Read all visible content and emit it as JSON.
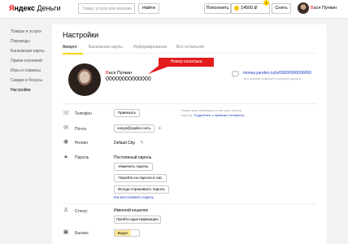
{
  "header": {
    "logo_part1": "Я",
    "logo_part2": "ндекс",
    "logo_part3": "Деньги",
    "search_placeholder": "Товар, услуги или магазин",
    "search_button": "Найти",
    "topup_button": "Пополнить",
    "balance": "14500 ₽",
    "notification_count": "1",
    "withdraw_button": "Снять",
    "user_first_letter": "В",
    "user_rest": "ася Пупкин"
  },
  "sidebar": {
    "items": [
      {
        "label": "Товары и услуги"
      },
      {
        "label": "Переводы"
      },
      {
        "label": "Банковские карты"
      },
      {
        "label": "Прием платежей"
      },
      {
        "label": "Игры и сервисы"
      },
      {
        "label": "Скидки и бонусы"
      },
      {
        "label": "Настройки"
      }
    ]
  },
  "main": {
    "title": "Настройки",
    "tabs": [
      {
        "label": "Аккаунт"
      },
      {
        "label": "Банковские карты"
      },
      {
        "label": "Информирование"
      },
      {
        "label": "Все остальное"
      }
    ],
    "profile": {
      "name_first_letter": "В",
      "name_rest": "ася Пупкин",
      "wallet_number": "00000000000000",
      "callout": "Номер кошелька",
      "public_link": "money.yandex.ru/to/00000000000000",
      "public_link_note": "Эта ссылка помогает получать деньги"
    },
    "phone": {
      "label": "Телефон",
      "button": "Привязать",
      "note_line1": "Нужен для переводов и смс для сброса",
      "note_line2_text": "пароля.",
      "note_line2_link": "Подробнее о привязке телефона"
    },
    "email": {
      "label": "Почта",
      "value": "vasya@yapkin.com"
    },
    "region": {
      "label": "Регион",
      "value": "Default City"
    },
    "password": {
      "label": "Пароль",
      "value": "Постоянный пароль",
      "change_button": "Изменить пароль",
      "one_time_button": "Перейти на пароли в смс",
      "always_ask_button": "Всегда спрашивать пароль",
      "restore_link": "Как восстановить пароль"
    },
    "status": {
      "label": "Статус",
      "value": "Именной кошелек",
      "identify_button": "Пройти идентификацию"
    },
    "balance": {
      "label": "Баланс",
      "toggle_label": "Виден"
    }
  },
  "colors": {
    "accent": "#ffd200",
    "red": "#e31b1b",
    "link": "#1a3dc1"
  }
}
